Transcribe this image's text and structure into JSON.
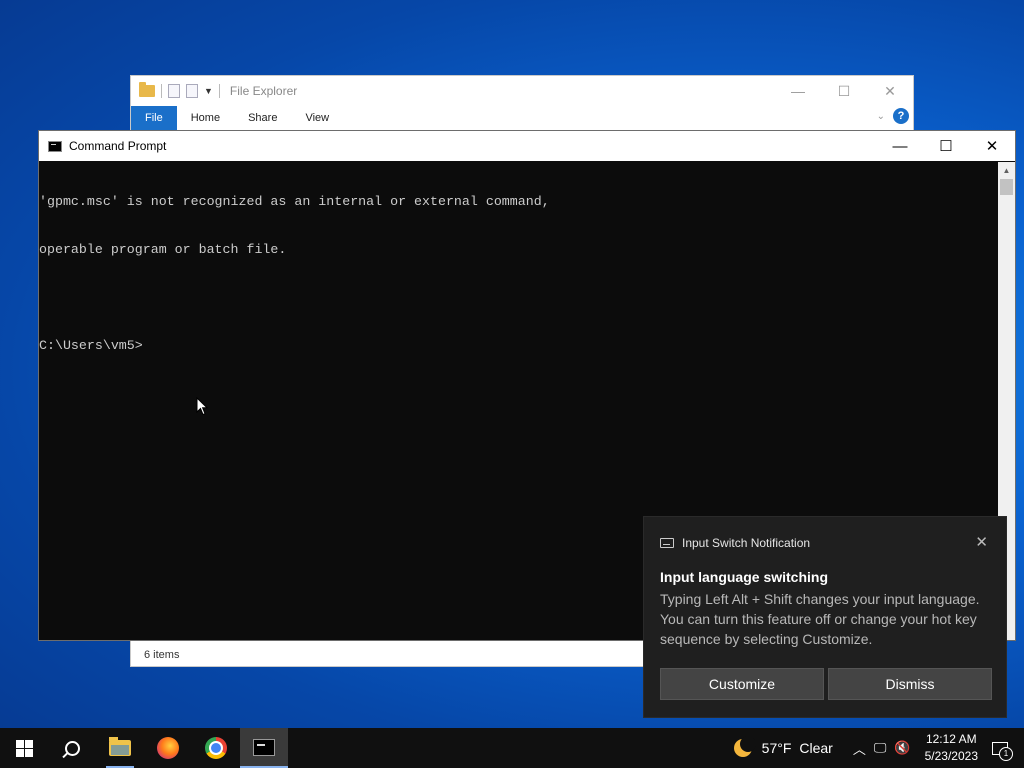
{
  "file_explorer": {
    "title": "File Explorer",
    "tabs": [
      "File",
      "Home",
      "Share",
      "View"
    ],
    "status": "6 items",
    "help_label": "?"
  },
  "cmd": {
    "title": "Command Prompt",
    "lines": [
      "'gpmc.msc' is not recognized as an internal or external command,",
      "operable program or batch file.",
      "",
      "C:\\Users\\vm5>"
    ]
  },
  "window_controls": {
    "minimize": "—",
    "maximize": "☐",
    "close": "✕"
  },
  "toast": {
    "app_name": "Input Switch Notification",
    "title": "Input language switching",
    "body": "Typing Left Alt + Shift changes your input language. You can turn this feature off or change your hot key sequence by selecting Customize.",
    "buttons": [
      "Customize",
      "Dismiss"
    ],
    "close": "✕"
  },
  "taskbar": {
    "apps": [
      "start-icon",
      "search-icon",
      "file-explorer-icon",
      "firefox-icon",
      "chrome-icon",
      "command-prompt-icon"
    ],
    "weather": {
      "temp": "57°F",
      "condition": "Clear"
    },
    "clock": {
      "time": "12:12 AM",
      "date": "5/23/2023"
    },
    "notification_count": "1"
  }
}
